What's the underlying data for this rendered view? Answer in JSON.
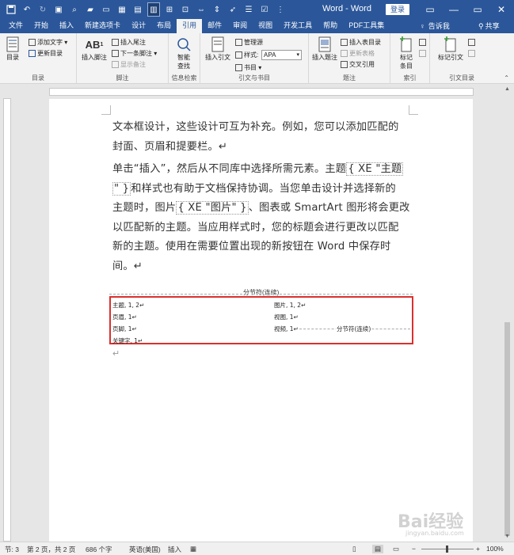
{
  "window": {
    "title": "Word - Word",
    "login_label": "登录",
    "minimize": "—",
    "restore": "▭",
    "close": "✕"
  },
  "tabs": [
    {
      "label": "文件"
    },
    {
      "label": "开始"
    },
    {
      "label": "插入"
    },
    {
      "label": "新建选项卡"
    },
    {
      "label": "设计"
    },
    {
      "label": "布局"
    },
    {
      "label": "引用"
    },
    {
      "label": "邮件"
    },
    {
      "label": "审阅"
    },
    {
      "label": "视图"
    },
    {
      "label": "开发工具"
    },
    {
      "label": "帮助"
    },
    {
      "label": "PDF工具集"
    }
  ],
  "tab_extra": {
    "tell_me": "告诉我",
    "share": "共享"
  },
  "ribbon": {
    "toc": {
      "group": "目录",
      "big": "目录",
      "add_text": "添加文字 ▾",
      "update": "更新目录"
    },
    "footnotes": {
      "group": "脚注",
      "big": "插入脚注",
      "insert_endnote": "插入尾注",
      "next_footnote": "下一条脚注 ▾",
      "show_notes": "显示备注"
    },
    "research": {
      "group": "信息检索",
      "big_line1": "智能",
      "big_line2": "查找"
    },
    "citations": {
      "group": "引文与书目",
      "big": "插入引文",
      "manage": "管理源",
      "style_label": "样式:",
      "style_value": "APA",
      "bibliography": "书目 ▾"
    },
    "captions": {
      "group": "题注",
      "big": "插入题注",
      "insert_table": "插入表目录",
      "update_table": "更新表格",
      "cross_ref": "交叉引用"
    },
    "index": {
      "group": "索引",
      "big_line1": "标记",
      "big_line2": "条目"
    },
    "toa": {
      "group": "引文目录",
      "big": "标记引文"
    }
  },
  "document": {
    "para1_line1": "文本框设计，这些设计可互为补充。例如，您可以添加匹配的",
    "para1_line2": "封面、页眉和提要栏。↵",
    "para2_line1a": "单击“插入”，然后从不同库中选择所需元素。主题",
    "field1": "{ XE \"主题",
    "field1_end": "\" }",
    "para2_line2b": "和样式也有助于文档保持协调。当您单击设计并选择新的",
    "para2_line3a": "主题时，图片",
    "field2": "{ XE \"图片\" }",
    "para2_line3b": "、图表或 SmartArt 图形将会更改",
    "para2_line4": "以匹配新的主题。当应用样式时，您的标题会进行更改以匹配",
    "para2_line5": "新的主题。使用在需要位置出现的新按钮在 Word 中保存时",
    "para2_line6": "间。↵",
    "section_break": "分节符(连续)",
    "index_entries": {
      "a1": "主题, 1, 2↵",
      "a2": "页眉, 1↵",
      "a3": "页脚, 1↵",
      "a4": "关键字, 1↵",
      "b1": "图片, 1, 2↵",
      "b2": "视图, 1↵",
      "b3": "视频, 1↵",
      "b3_break": "分节符(连续)"
    },
    "end_mark": "↵"
  },
  "statusbar": {
    "section": "节: 3",
    "page": "第 2 页，共 2 页",
    "words": "686 个字",
    "language": "英语(美国)",
    "mode": "插入",
    "zoom": "100%",
    "zoom_minus": "−",
    "zoom_plus": "+"
  },
  "watermark": {
    "text": "Bai经验",
    "sub": "jingyan.baidu.com"
  },
  "colors": {
    "accent": "#2b579a",
    "highlight": "#d9312e"
  }
}
